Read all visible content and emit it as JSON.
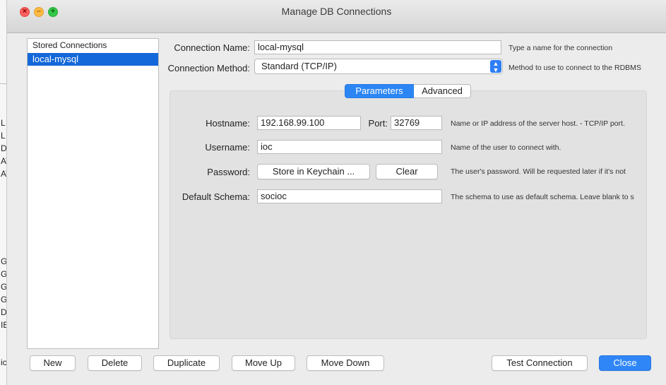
{
  "window": {
    "title": "Manage DB Connections"
  },
  "traffic_lights": {
    "close_glyph": "×",
    "min_glyph": "–",
    "max_glyph": "+"
  },
  "background_app_fragments": [
    "L",
    "L",
    "D",
    "AT",
    "AT",
    "G",
    "G",
    "G",
    "G",
    "DI",
    "IE",
    "ic"
  ],
  "sidebar": {
    "header": "Stored Connections",
    "items": [
      {
        "label": "local-mysql",
        "selected": true
      }
    ]
  },
  "form": {
    "connection_name": {
      "label": "Connection Name:",
      "value": "local-mysql",
      "hint": "Type a name for the connection"
    },
    "connection_method": {
      "label": "Connection Method:",
      "value": "Standard (TCP/IP)",
      "hint": "Method to use to connect to the RDBMS"
    }
  },
  "tabs": [
    {
      "label": "Parameters",
      "active": true
    },
    {
      "label": "Advanced",
      "active": false
    }
  ],
  "parameters": {
    "hostname": {
      "label": "Hostname:",
      "value": "192.168.99.100"
    },
    "port": {
      "label": "Port:",
      "value": "32769"
    },
    "hostname_hint": "Name or IP address of the server host. - TCP/IP port.",
    "username": {
      "label": "Username:",
      "value": "ioc",
      "hint": "Name of the user to connect with."
    },
    "password": {
      "label": "Password:",
      "store_button": "Store in Keychain ...",
      "clear_button": "Clear",
      "hint": "The user's password. Will be requested later if it's not"
    },
    "default_schema": {
      "label": "Default Schema:",
      "value": "socioc",
      "hint": "The schema to use as default schema. Leave blank to s"
    }
  },
  "footer": {
    "new": "New",
    "delete": "Delete",
    "duplicate": "Duplicate",
    "move_up": "Move Up",
    "move_down": "Move Down",
    "test_connection": "Test Connection",
    "close": "Close"
  },
  "colors": {
    "accent": "#2f86f6",
    "selection": "#1468d9",
    "window_bg": "#ececec",
    "panel_bg": "#e2e2e2"
  },
  "icons": {
    "select_arrow": "chevron-up-down-icon"
  }
}
